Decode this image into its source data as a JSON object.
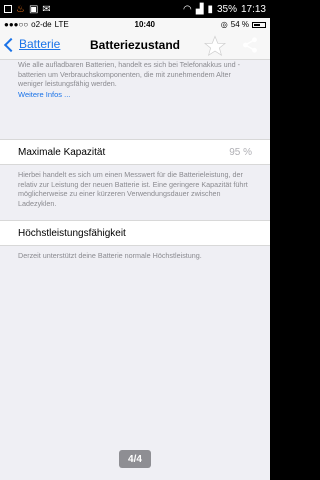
{
  "android_status": {
    "time": "17:13",
    "battery": "35%"
  },
  "ios_status": {
    "carrier": "o2-de",
    "network": "LTE",
    "time": "10:40",
    "battery": "54 %"
  },
  "navbar": {
    "back_label": "Batterie",
    "title": "Batteriezustand"
  },
  "intro": {
    "text": "Wie alle aufladbaren Batterien, handelt es sich bei Telefonakkus und -batterien um Verbrauchskomponenten, die mit zunehmendem Alter weniger leistungsfähig werden.",
    "link": "Weitere Infos ..."
  },
  "capacity": {
    "label": "Maximale Kapazität",
    "value": "95 %",
    "description": "Hierbei handelt es sich um einen Messwert für die Batterieleistung, der relativ zur Leistung der neuen Batterie ist. Eine geringere Kapazität führt möglicherweise zu einer kürzeren Verwendungsdauer zwischen Ladezyklen."
  },
  "peak": {
    "label": "Höchstleistungsfähigkeit",
    "description": "Derzeit unterstützt deine Batterie normale Höchstleistung."
  },
  "page_indicator": "4/4"
}
